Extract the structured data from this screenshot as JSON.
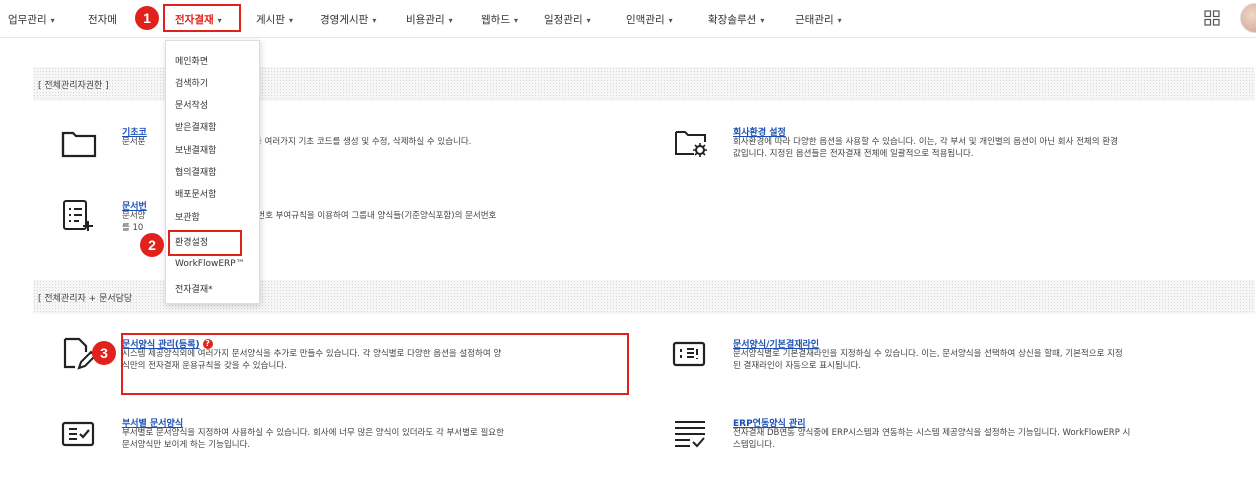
{
  "nav": {
    "items": [
      {
        "label": "업무관리"
      },
      {
        "label": "전자메"
      },
      {
        "label": "전자결재"
      },
      {
        "label": "게시판"
      },
      {
        "label": "경영게시판"
      },
      {
        "label": "비용관리"
      },
      {
        "label": "웹하드"
      },
      {
        "label": "일정관리"
      },
      {
        "label": "인맥관리"
      },
      {
        "label": "확장솔루션"
      },
      {
        "label": "근태관리"
      }
    ],
    "caret": "▾",
    "accent": "#e1211b"
  },
  "badges": [
    "1",
    "2",
    "3"
  ],
  "dropdown": {
    "items": [
      "메인화면",
      "검색하기",
      "문서작성",
      "받은결재함",
      "보낸결재함",
      "협의결재함",
      "배포문서함",
      "보관함",
      "환경설정",
      "WorkFlowERP™",
      "전자결재*"
    ]
  },
  "sections": [
    {
      "header": "[ 전체관리자권한 ]"
    },
    {
      "header": "[ 전체관리자 + 문서담당"
    }
  ],
  "items": {
    "basic_code": {
      "title": "기초코",
      "desc1": "문서분",
      "desc1_tail": "출, 출장지역등 여러가지 기초 코드를 생성 및 수정, 삭제하실 수 있습니다.",
      "icon": "folder-icon"
    },
    "company_env": {
      "title": "회사환경 설정",
      "desc1": "회사환경에 따라 다양한 옵션을 사용할 수 있습니다. 이는, 각 부서 및 개인별의 옵션이 아닌 회사 전체의 환경",
      "desc2": "값입니다. 지정된 옵션들은 전자결재 전체에 일괄적으로 적용됩니다.",
      "icon": "folder-gear-icon"
    },
    "doc_number": {
      "title": "문서번",
      "desc1": "문서양",
      "desc1_tail": "양식의 문서번호 부여규칙을 이용하여 그룹내 양식들(기준양식포함)의 문서번호",
      "desc2": "를 10",
      "icon": "list-add-icon"
    },
    "form_manage": {
      "title": "문서양식 관리(등록)",
      "desc1": "시스템 제공양식외에 여러가지 문서양식을 추가로 만들수 있습니다. 각 양식별로 다양한 옵션을 설정하여 양",
      "desc2": "식만의 전자결재 운용규칙을 갖을 수 있습니다.",
      "icon": "document-edit-icon",
      "help": "?"
    },
    "form_default_line": {
      "title": "문서양식/기본결재라인",
      "desc1": "문서양식별로 기본결재라인을 지정하실 수 있습니다. 이는, 문서양식을 선택하여 상신을 할때, 기본적으로 지정",
      "desc2": "된 결재라인이 자동으로 표시됩니다.",
      "icon": "alert-box-icon"
    },
    "dept_form": {
      "title": "부서별 문서양식",
      "desc1": "부서별로 문서양식을 지정하여 사용하실 수 있습니다. 회사에 너무 많은 양식이 있더라도 각 부서별로 필요한",
      "desc2": "문서양식만 보이게 하는 기능입니다.",
      "icon": "checkbox-icon"
    },
    "erp_form": {
      "title": "ERP연동양식 관리",
      "desc1": "전자결재 DB연동 양식중에 ERP시스템과 연동하는 시스템 제공양식을 설정하는 기능입니다. WorkFlowERP 시",
      "desc2": "스템입니다.",
      "icon": "list-check-icon"
    }
  }
}
